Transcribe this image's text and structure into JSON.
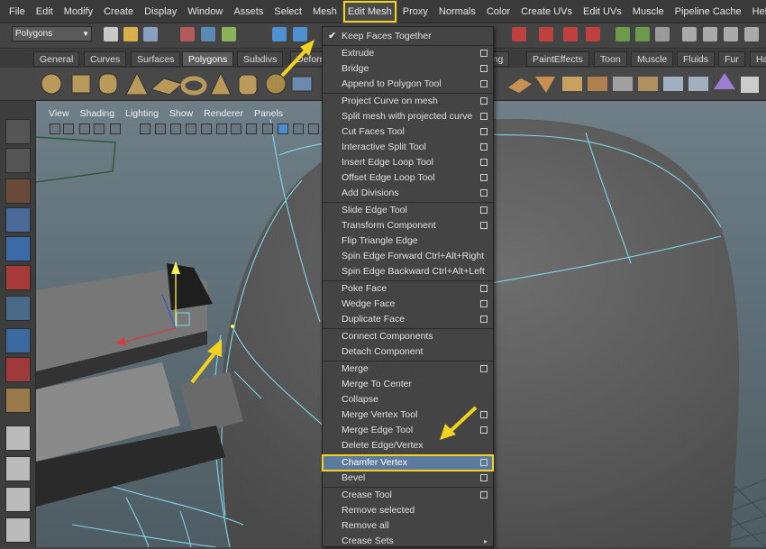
{
  "menubar": [
    "File",
    "Edit",
    "Modify",
    "Create",
    "Display",
    "Window",
    "Assets",
    "Select",
    "Mesh",
    "Edit Mesh",
    "Proxy",
    "Normals",
    "Color",
    "Create UVs",
    "Edit UVs",
    "Muscle",
    "Pipeline Cache",
    "Help"
  ],
  "statusline": {
    "mode": "Polygons"
  },
  "shelf_tabs": [
    "General",
    "Curves",
    "Surfaces",
    "Polygons",
    "Subdivs",
    "Deform",
    "ering",
    "PaintEffects",
    "Toon",
    "Muscle",
    "Fluids",
    "Fur",
    "Ha"
  ],
  "shelf_active": "Polygons",
  "viewport_menu": [
    "View",
    "Shading",
    "Lighting",
    "Show",
    "Renderer",
    "Panels"
  ],
  "edit_mesh_menu": [
    {
      "label": "Keep Faces Together",
      "check": true
    },
    {
      "label": "Extrude",
      "opt": true
    },
    {
      "label": "Bridge",
      "opt": true
    },
    {
      "label": "Append to Polygon Tool",
      "opt": true
    },
    {
      "label": "Project Curve on mesh",
      "opt": true
    },
    {
      "label": "Split mesh with projected curve",
      "opt": true
    },
    {
      "label": "Cut Faces Tool",
      "opt": true
    },
    {
      "label": "Interactive Split Tool",
      "opt": true
    },
    {
      "label": "Insert Edge Loop Tool",
      "opt": true
    },
    {
      "label": "Offset Edge Loop Tool",
      "opt": true
    },
    {
      "label": "Add Divisions",
      "opt": true
    },
    {
      "label": "Slide Edge Tool",
      "opt": true
    },
    {
      "label": "Transform Component",
      "opt": true
    },
    {
      "label": "Flip Triangle Edge"
    },
    {
      "label": "Spin Edge Forward  Ctrl+Alt+Right"
    },
    {
      "label": "Spin Edge Backward  Ctrl+Alt+Left"
    },
    {
      "label": "Poke Face",
      "opt": true
    },
    {
      "label": "Wedge Face",
      "opt": true
    },
    {
      "label": "Duplicate Face",
      "opt": true
    },
    {
      "label": "Connect Components"
    },
    {
      "label": "Detach Component"
    },
    {
      "label": "Merge",
      "opt": true
    },
    {
      "label": "Merge To Center"
    },
    {
      "label": "Collapse"
    },
    {
      "label": "Merge Vertex Tool",
      "opt": true
    },
    {
      "label": "Merge Edge Tool",
      "opt": true
    },
    {
      "label": "Delete Edge/Vertex"
    },
    {
      "label": "Chamfer Vertex",
      "opt": true,
      "highlight": true
    },
    {
      "label": "Bevel",
      "opt": true
    },
    {
      "label": "Crease Tool",
      "opt": true
    },
    {
      "label": "Remove selected"
    },
    {
      "label": "Remove all"
    },
    {
      "label": "Crease Sets",
      "submenu": true
    }
  ],
  "colors": {
    "highlight": "#f2d21e",
    "selection": "#5b7a9d",
    "wire": "#7fd6e8"
  }
}
